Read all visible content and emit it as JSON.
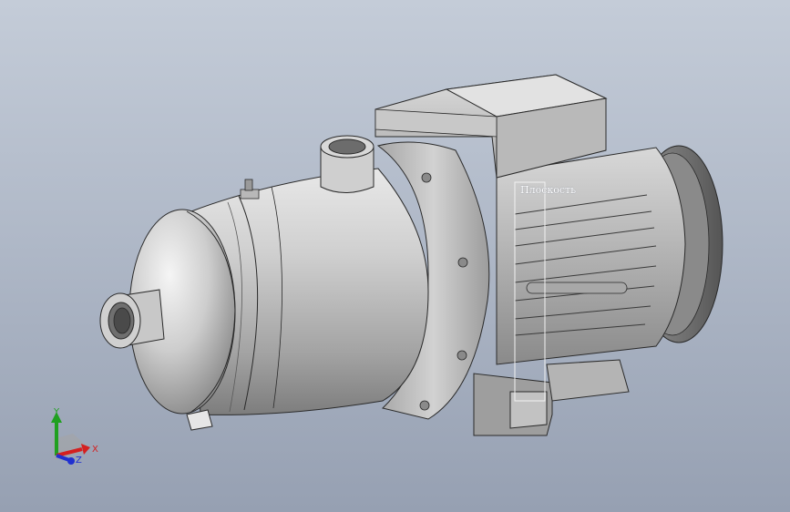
{
  "viewport": {
    "background_top": "#c4ccd8",
    "background_bottom": "#96a0b2"
  },
  "model": {
    "name": "centrifugal-pump",
    "body_color": "#bcbcbc",
    "edge_color": "#2a2a2a"
  },
  "reference_plane": {
    "label": "Плоскость"
  },
  "triad": {
    "x_label": "X",
    "y_label": "Y",
    "z_label": "Z",
    "x_color": "#d42020",
    "y_color": "#20a020",
    "z_color": "#2030d0"
  }
}
